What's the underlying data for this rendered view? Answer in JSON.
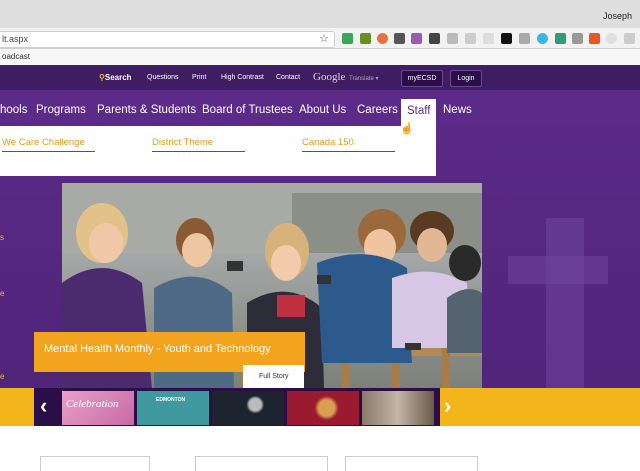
{
  "browser": {
    "profile_name": "Joseph",
    "url": "lt.aspx",
    "bookmark": "oadcast"
  },
  "topbar": {
    "search": "Search",
    "questions": "Questions",
    "print": "Print",
    "high_contrast": "High Contrast",
    "contact": "Contact",
    "google": "Google",
    "translate": "Translate ▾",
    "myecsd": "myECSD",
    "login": "Login"
  },
  "nav": {
    "items": [
      "hools",
      "Programs",
      "Parents & Students",
      "Board of Trustees",
      "About Us",
      "Careers",
      "Staff",
      "News"
    ]
  },
  "dropdown": {
    "items": [
      "We Care Challenge",
      "District Theme",
      "Canada 150"
    ]
  },
  "sidebar_fragments": [
    "s",
    "e",
    "e"
  ],
  "hero": {
    "caption": "Mental Health Monthly - Youth and Technology",
    "button": "Full Story"
  },
  "carousel": {
    "thumb1": "Celebration",
    "thumb2": "EDMONTON"
  },
  "colors": {
    "brand_purple": "#5c2a88",
    "dark_purple": "#3f1d63",
    "accent_orange": "#f3a41e",
    "carousel_yellow": "#f4b51b"
  }
}
